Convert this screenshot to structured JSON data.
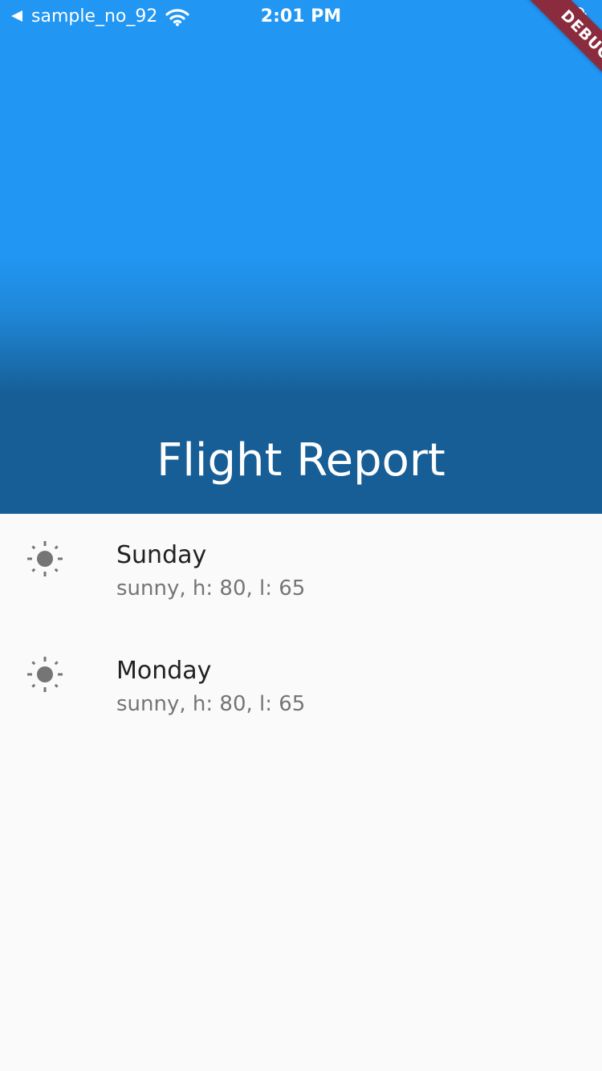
{
  "status_bar": {
    "back_app": "sample_no_92",
    "time": "2:01 PM"
  },
  "debug_banner": "DEBUG",
  "header": {
    "title": "Flight Report",
    "colors": {
      "top": "#2196f3",
      "bottom": "#175e97"
    }
  },
  "list": {
    "items": [
      {
        "icon": "sun-icon",
        "title": "Sunday",
        "subtitle": "sunny, h: 80, l: 65"
      },
      {
        "icon": "sun-icon",
        "title": "Monday",
        "subtitle": "sunny, h: 80, l: 65"
      }
    ]
  }
}
